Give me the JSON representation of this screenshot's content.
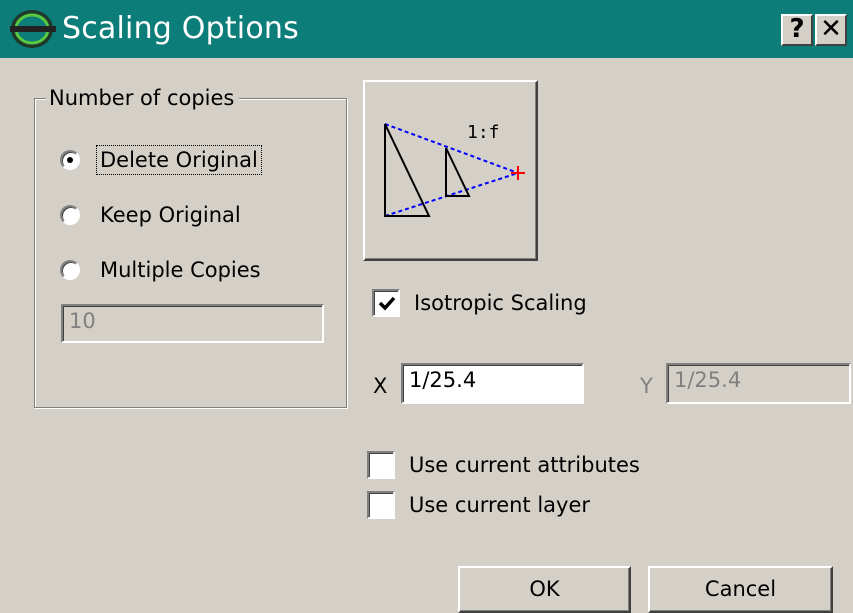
{
  "window": {
    "title": "Scaling Options",
    "help_label": "?",
    "close_label": "✕"
  },
  "copies_group": {
    "label": "Number of copies",
    "options": [
      {
        "label": "Delete Original",
        "selected": true
      },
      {
        "label": "Keep Original",
        "selected": false
      },
      {
        "label": "Multiple Copies",
        "selected": false
      }
    ],
    "copies_value": "10"
  },
  "preview": {
    "ratio_label": "1:f"
  },
  "isotropic": {
    "label": "Isotropic Scaling",
    "checked": true
  },
  "scale": {
    "x_label": "X",
    "x_value": "1/25.4",
    "y_label": "Y",
    "y_value": "1/25.4"
  },
  "options": {
    "current_attributes_label": "Use current attributes",
    "current_layer_label": "Use current layer"
  },
  "buttons": {
    "ok_label": "OK",
    "cancel_label": "Cancel"
  },
  "colors": {
    "titlebar": "#0c7d78",
    "face": "#d4d0c8",
    "preview_dash": "#0000ff",
    "scale_point": "#ff0000"
  }
}
